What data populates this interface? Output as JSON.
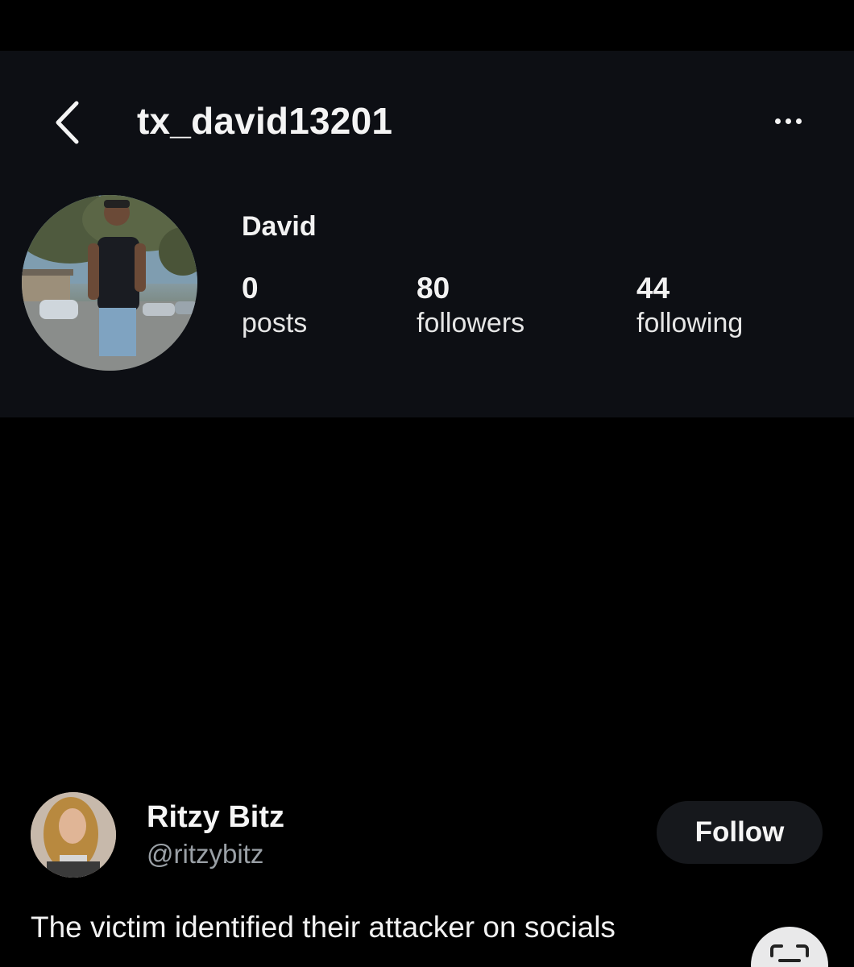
{
  "instagram_profile": {
    "username": "tx_david13201",
    "display_name": "David",
    "stats": [
      {
        "count": "0",
        "label": "posts"
      },
      {
        "count": "80",
        "label": "followers"
      },
      {
        "count": "44",
        "label": "following"
      }
    ],
    "icons": {
      "back": "chevron-left-icon",
      "more": "more-horizontal-icon",
      "avatar": "profile-photo"
    }
  },
  "tweet": {
    "author_name": "Ritzy Bitz",
    "author_handle": "@ritzybitz",
    "follow_label": "Follow",
    "text": "The victim identified their attacker on socials",
    "icons": {
      "avatar": "author-avatar-photo",
      "scan": "text-scan-icon"
    }
  },
  "colors": {
    "background": "#000000",
    "panel": "#0d0f14",
    "handle": "#9aa0a6",
    "follow_button": "#16181c"
  }
}
